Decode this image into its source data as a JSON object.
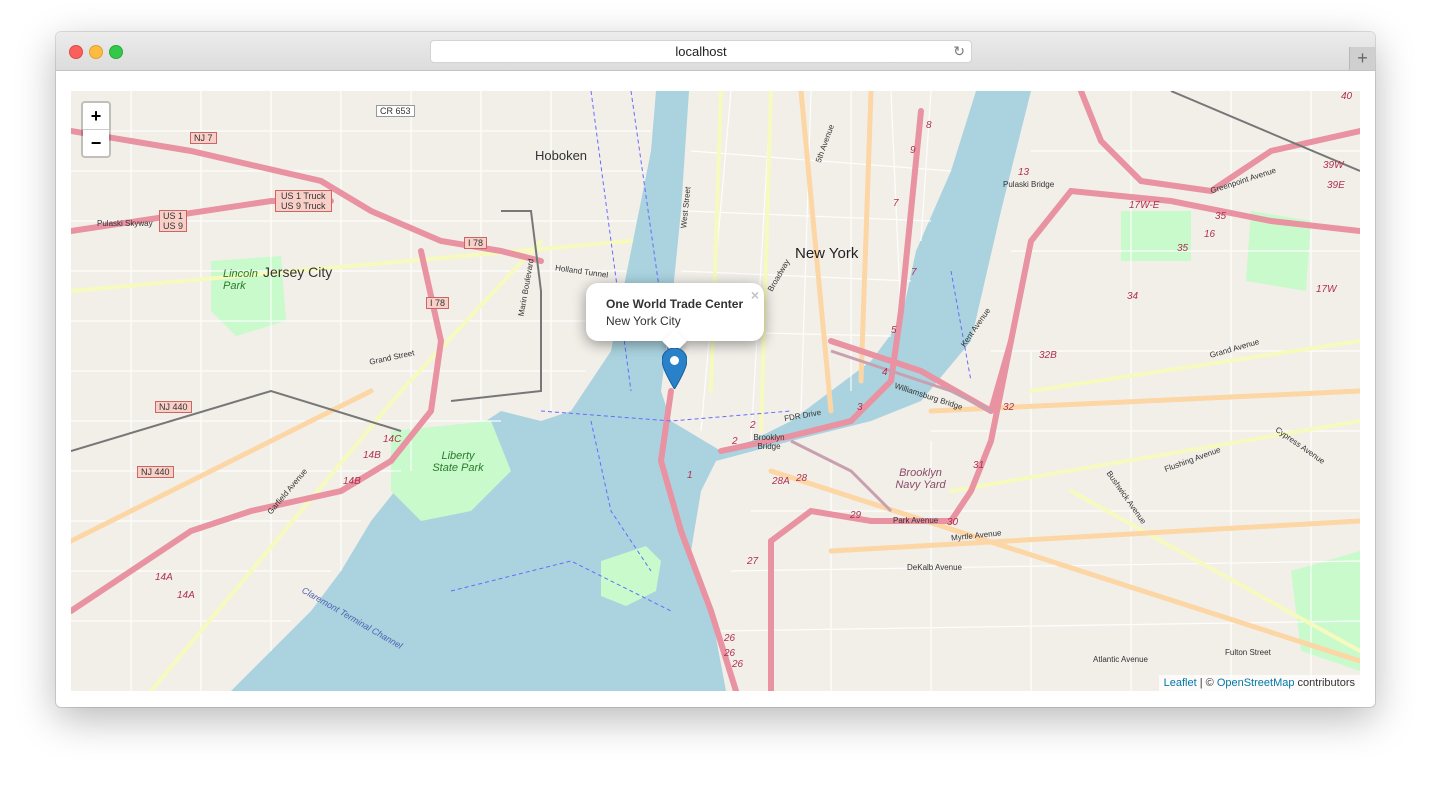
{
  "browser": {
    "url": "localhost",
    "reload_icon": "reload-icon",
    "new_tab_icon": "plus-icon",
    "new_tab_label": "+",
    "reload_glyph": "↻"
  },
  "map": {
    "zoom_in_label": "+",
    "zoom_out_label": "−",
    "popup": {
      "title": "One World Trade Center",
      "subtitle": "New York City",
      "close_label": "×"
    },
    "attribution": {
      "leaflet": "Leaflet",
      "separator": " | © ",
      "osm": "OpenStreetMap",
      "contributors": " contributors"
    },
    "labels": {
      "hoboken": "Hoboken",
      "new_york": "New York",
      "jersey_city": "Jersey City",
      "lincoln_park": "Lincoln Park",
      "liberty_state_park": "Liberty State Park",
      "brooklyn_navy_yard": "Brooklyn Navy Yard",
      "brooklyn_bridge": "Brooklyn Bridge",
      "williamsburg_bridge": "Williamsburg Bridge",
      "pulaski_bridge": "Pulaski Bridge",
      "holland_tunnel": "Holland Tunnel",
      "grand_street": "Grand Street",
      "fdr_drive": "FDR Drive",
      "atlantic_avenue": "Atlantic Avenue",
      "fulton_street": "Fulton Street",
      "dekalb_avenue": "DeKalb Avenue",
      "myrtle_avenue": "Myrtle Avenue",
      "park_avenue": "Park Avenue",
      "flushing_avenue": "Flushing Avenue",
      "bushwick_avenue": "Bushwick Avenue",
      "cypress_avenue": "Cypress Avenue",
      "grand_avenue": "Grand Avenue",
      "greenpoint_avenue": "Greenpoint Avenue",
      "kent_avenue": "Kent Avenue",
      "pulaski_skyway": "Pulaski Skyway",
      "claremont_terminal_channel": "Claremont Terminal Channel",
      "garfield_avenue": "Garfield Avenue",
      "marin_boulevard": "Marin Boulevard",
      "west_street": "West Street",
      "fifth_avenue": "5th Avenue",
      "broadway": "Broadway"
    },
    "shields": {
      "nj7": "NJ 7",
      "cr653": "CR 653",
      "us1_truck": "US 1 Truck",
      "us9_truck": "US 9 Truck",
      "us1": "US 1",
      "us9": "US 9",
      "i78a": "I 78",
      "i78b": "I 78",
      "nj440a": "NJ 440",
      "nj440b": "NJ 440"
    },
    "exits": [
      "14C",
      "14B",
      "14B",
      "14A",
      "14A",
      "1",
      "2",
      "2",
      "3",
      "4",
      "5",
      "7",
      "7",
      "8",
      "9",
      "13",
      "17W-E",
      "35",
      "16",
      "35",
      "34",
      "32B",
      "32",
      "31",
      "30",
      "29",
      "28A",
      "28",
      "27",
      "26",
      "26",
      "26",
      "39W",
      "39E",
      "17W",
      "40"
    ],
    "marker_icon": "map-marker-icon",
    "colors": {
      "water": "#aad3df",
      "land": "#f2efe9",
      "park": "#c8facc",
      "motorway": "#e892a2",
      "primary": "#fcd6a4",
      "secondary": "#f7fabf",
      "marker": "#2981ca"
    }
  }
}
